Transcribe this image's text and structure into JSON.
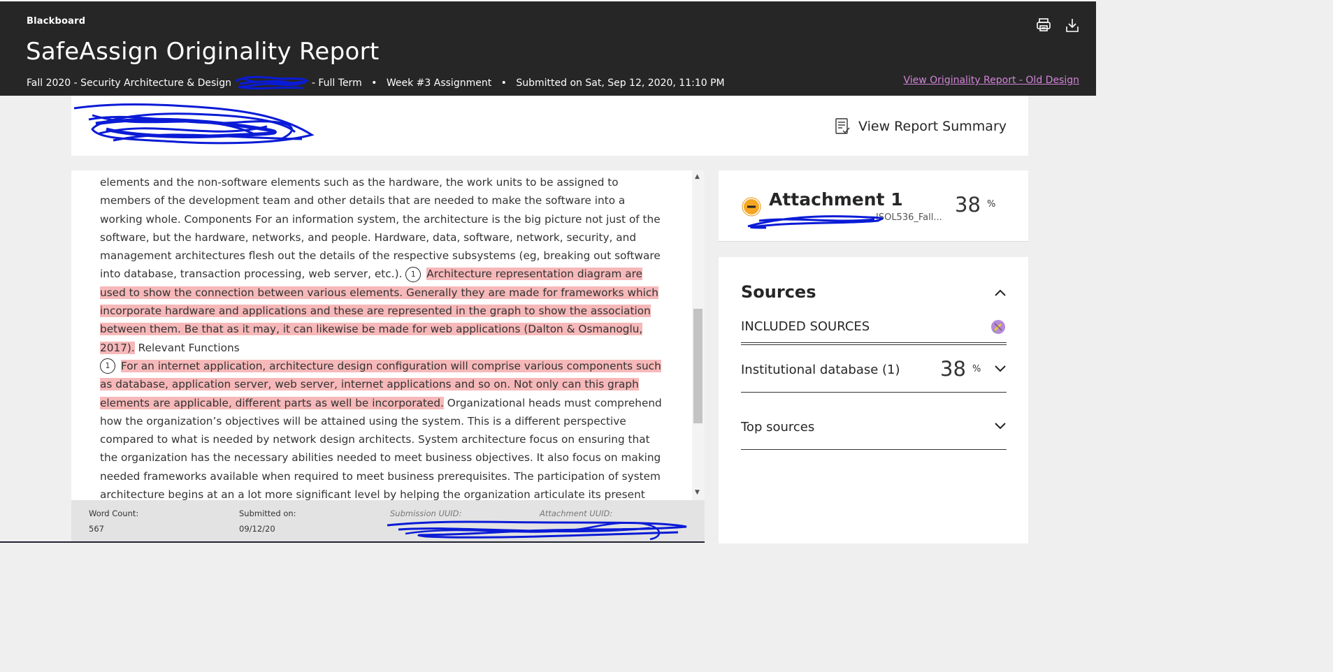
{
  "header": {
    "brand": "Blackboard",
    "title": "SafeAssign Originality Report",
    "course": "Fall 2020 - Security Architecture & Design",
    "term": "- Full Term",
    "assignment": "Week #3 Assignment",
    "submitted": "Submitted on Sat, Sep 12, 2020, 11:10 PM",
    "old_design_link": "View Originality Report - Old Design",
    "separator": "•"
  },
  "toolbar": {
    "print_icon": "printer-icon",
    "download_icon": "download-icon"
  },
  "summary": {
    "label": "View Report Summary",
    "icon": "report-summary-icon"
  },
  "document": {
    "p1": "elements and the non-software elements such as the hardware, the work units to be assigned to members of the development team and other details that are needed to make the software into a working whole. Components For an information system, the architecture is the big picture not just of the software, but the hardware, networks, and people. Hardware, data, software, network, security, and management architectures flesh out the details of the respective subsystems (eg, breaking out software into database, transaction processing, web server, etc.).",
    "match1_num": "1",
    "hl1": "Architecture representation diagram are used to show the connection between various elements. Generally they are made for frameworks which incorporate hardware and applications and these are represented in the graph to show the association between them. Be that as it may, it can likewise be made for web applications (Dalton & Osmanoglu, 2017).",
    "after_hl1": "Relevant Functions",
    "match2_num": "1",
    "hl2": "For an internet application, architecture design configuration will comprise various components such as database, application server, web server, internet applications and so on. Not only can this graph elements are applicable, different parts as well be incorporated.",
    "p2": "Organizational heads must comprehend how the organization’s objectives will be attained using the system. This is a different perspective compared to what is needed by network design architects. System architecture focus on ensuring that the organization has the necessary abilities needed to meet business objectives. It also focus on making needed frameworks available when required to meet business prerequisites. The participation of system architecture begins at an a lot more significant level by helping the organization articulate its present"
  },
  "footer": {
    "word_count_label": "Word Count:",
    "word_count": "567",
    "submitted_label": "Submitted on:",
    "submitted_date": "09/12/20",
    "submission_uuid_label": "Submission UUID:",
    "attachment_uuid_label": "Attachment UUID:"
  },
  "attachment": {
    "name": "Attachment 1",
    "file": "ISOL536_Fall...",
    "percent": "38",
    "percent_sign": "%"
  },
  "sources": {
    "title": "Sources",
    "included_label": "INCLUDED SOURCES",
    "institutional_label": "Institutional database (1)",
    "institutional_percent": "38",
    "percent_sign": "%",
    "top_sources_label": "Top sources"
  },
  "colors": {
    "topbar_bg": "#262626",
    "highlight": "#f7b8b9",
    "link": "#d184d9",
    "match_badge": "#f5a623",
    "scribble": "#0a1bd6"
  }
}
